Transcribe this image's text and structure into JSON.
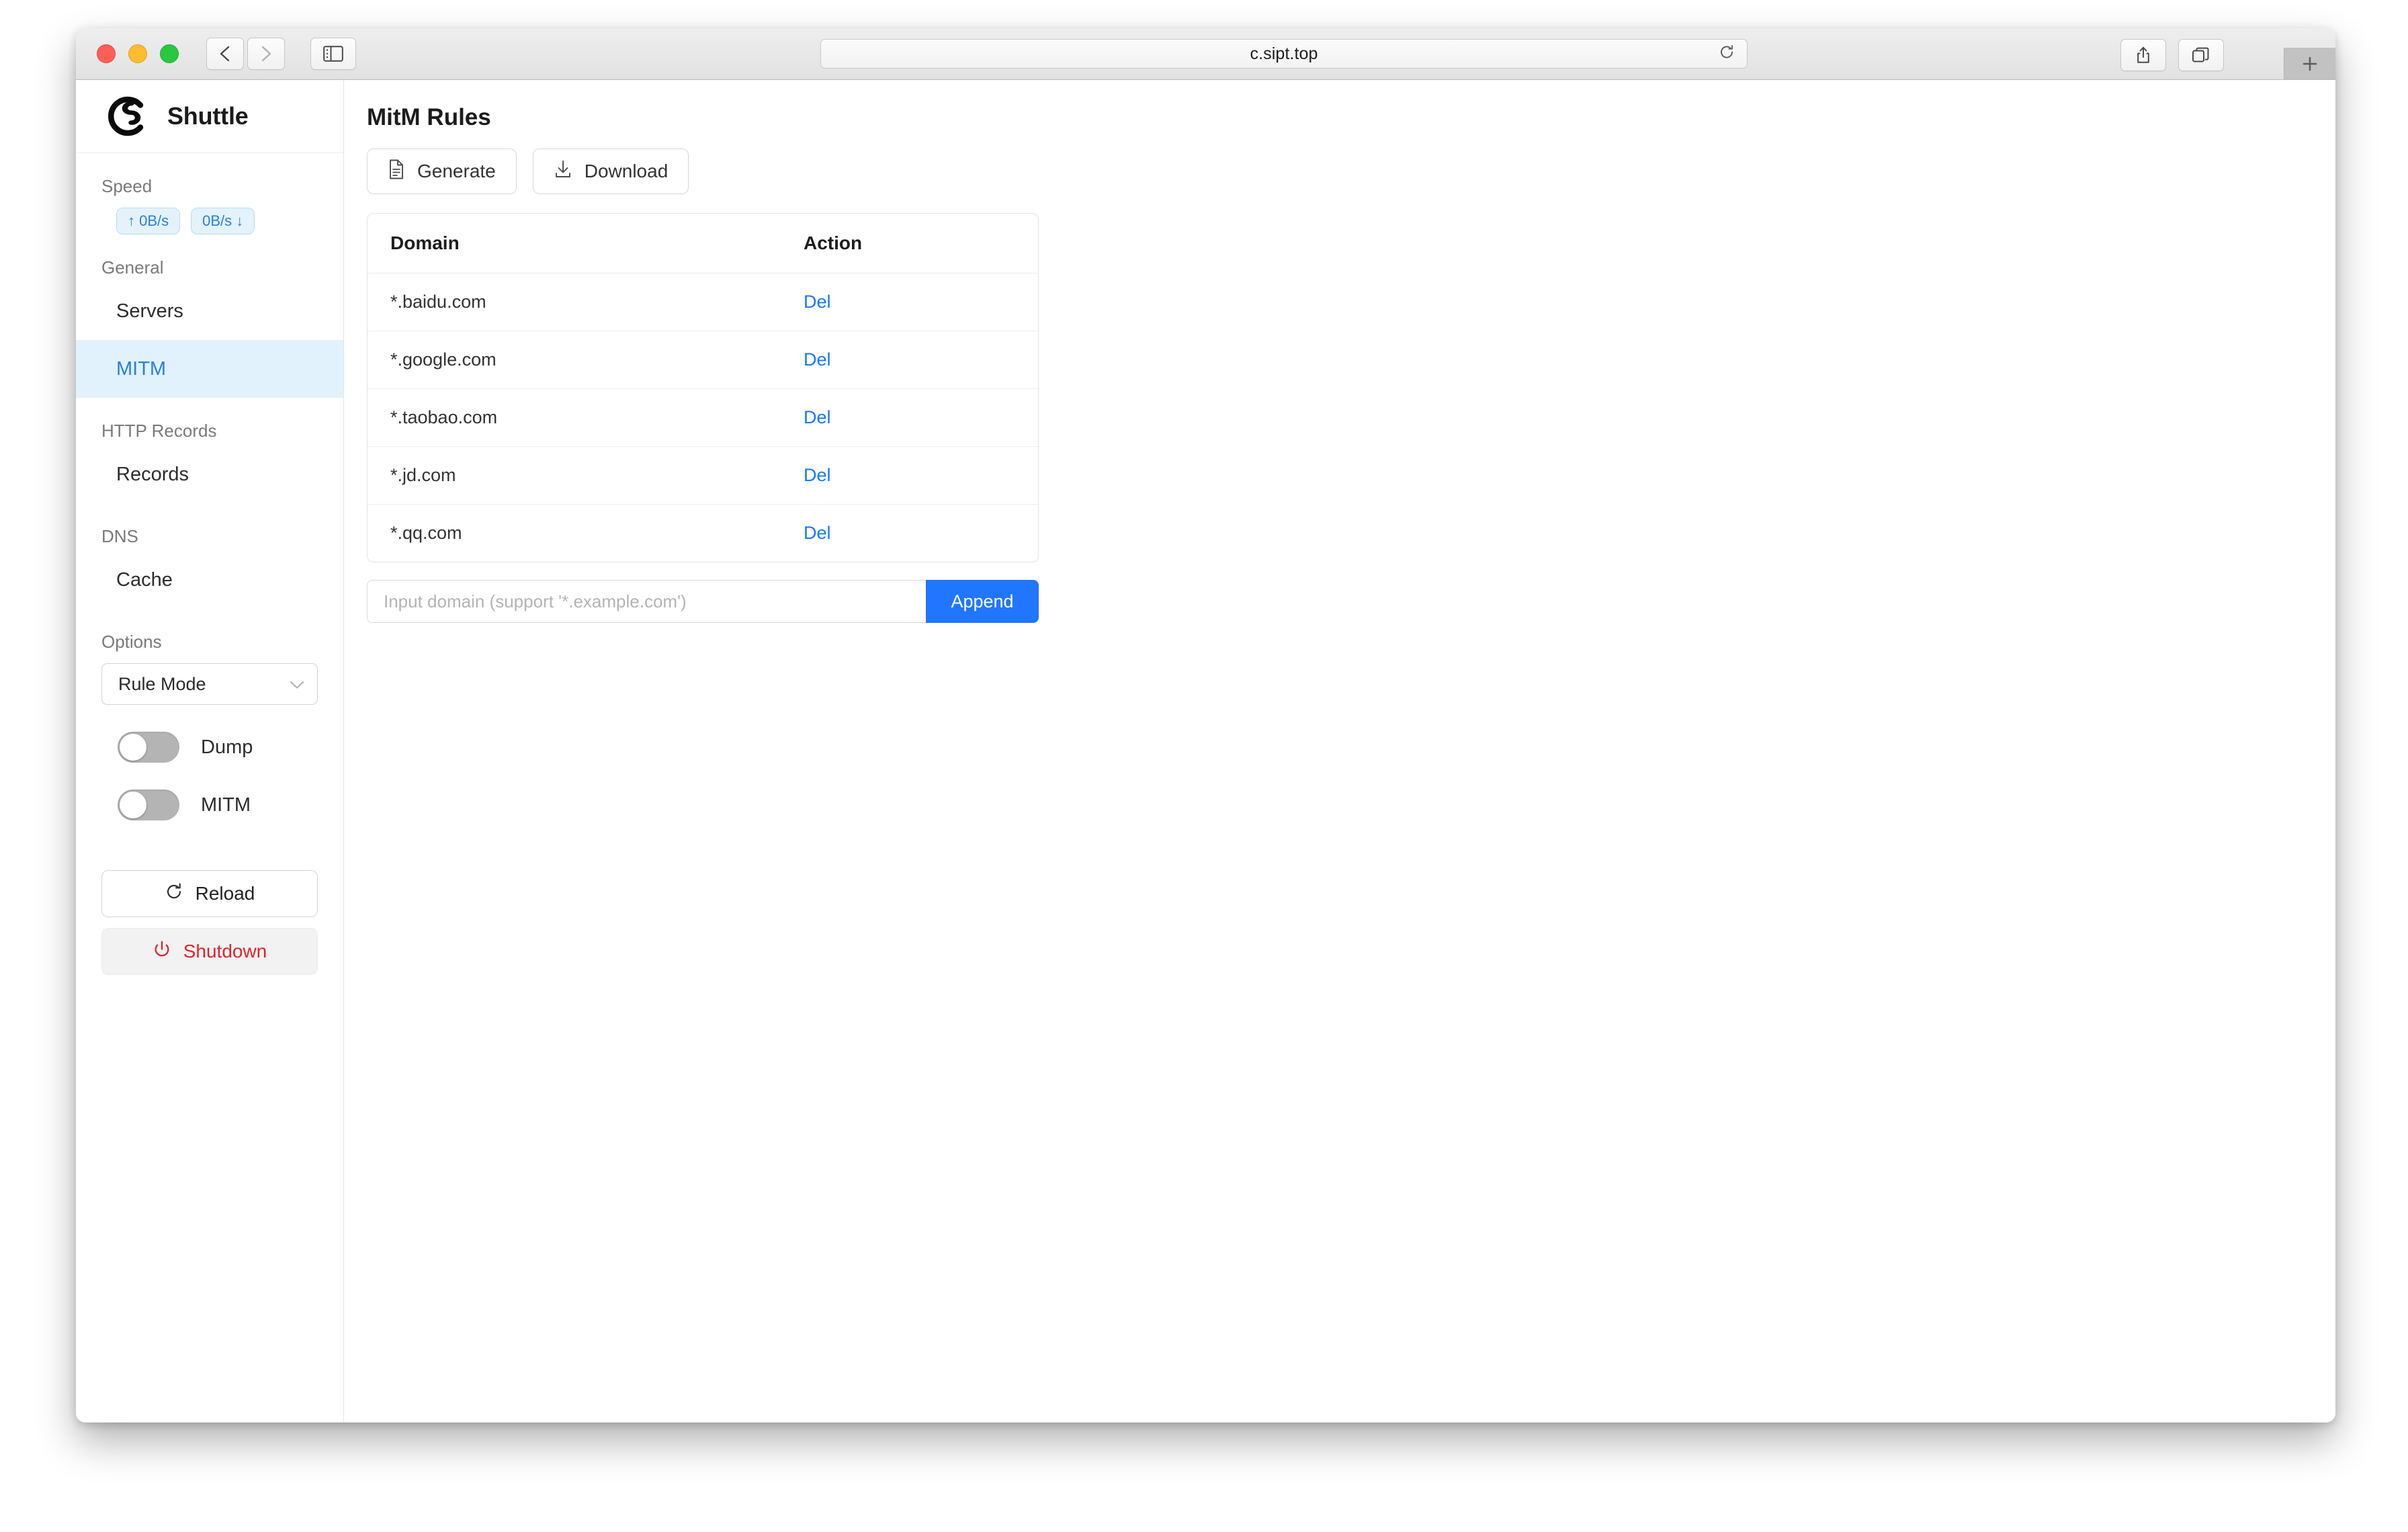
{
  "browser": {
    "url": "c.sipt.top",
    "icons": {
      "back": "back-chevron-icon",
      "forward": "forward-chevron-icon",
      "sidebar": "sidebar-toggle-icon",
      "reload": "reload-icon",
      "share": "share-icon",
      "tabs": "tab-overview-icon",
      "new_tab": "+"
    }
  },
  "sidebar": {
    "brand": "Shuttle",
    "speed": {
      "label": "Speed",
      "upload": "↑ 0B/s",
      "download": "0B/s ↓"
    },
    "groups": [
      {
        "label": "General",
        "items": [
          {
            "label": "Servers",
            "active": false
          },
          {
            "label": "MITM",
            "active": true
          }
        ]
      },
      {
        "label": "HTTP Records",
        "items": [
          {
            "label": "Records",
            "active": false
          }
        ]
      },
      {
        "label": "DNS",
        "items": [
          {
            "label": "Cache",
            "active": false
          }
        ]
      }
    ],
    "options": {
      "label": "Options",
      "mode_select": "Rule Mode",
      "toggles": [
        {
          "label": "Dump",
          "on": false
        },
        {
          "label": "MITM",
          "on": false
        }
      ],
      "reload_button": "Reload",
      "shutdown_button": "Shutdown"
    }
  },
  "main": {
    "title": "MitM Rules",
    "buttons": {
      "generate": "Generate",
      "download": "Download"
    },
    "table": {
      "columns": [
        "Domain",
        "Action"
      ],
      "rows": [
        {
          "domain": "*.baidu.com",
          "action": "Del"
        },
        {
          "domain": "*.google.com",
          "action": "Del"
        },
        {
          "domain": "*.taobao.com",
          "action": "Del"
        },
        {
          "domain": "*.jd.com",
          "action": "Del"
        },
        {
          "domain": "*.qq.com",
          "action": "Del"
        }
      ]
    },
    "append": {
      "placeholder": "Input domain (support '*.example.com')",
      "value": "",
      "button": "Append"
    }
  },
  "colors": {
    "accent_blue": "#2176ff",
    "link_blue": "#1677ff",
    "active_nav_bg": "#e2f2fd",
    "badge_bg": "#e3f2fd",
    "danger_red": "#e0232e"
  }
}
